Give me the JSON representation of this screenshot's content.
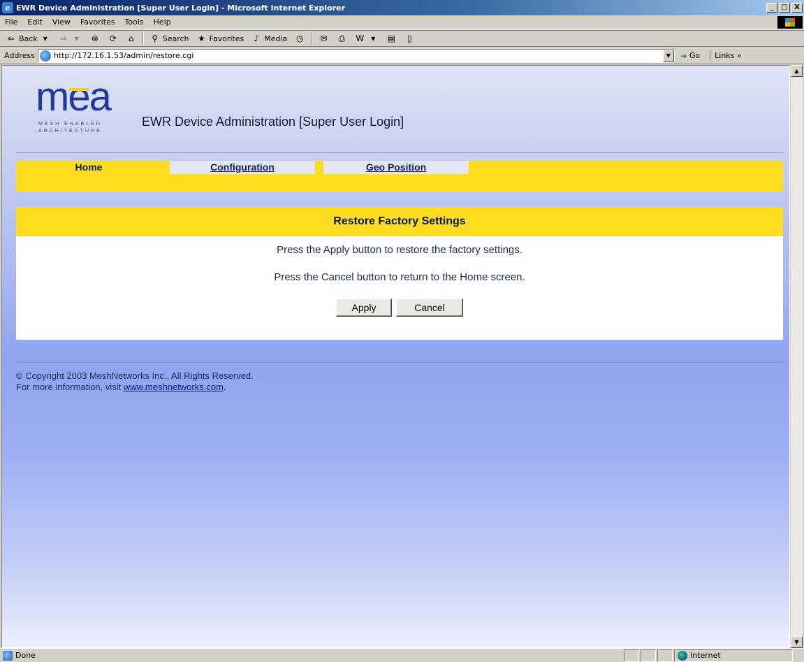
{
  "window": {
    "title": "EWR Device Administration [Super User Login] - Microsoft Internet Explorer",
    "minimize": "_",
    "maximize": "□",
    "close": "X"
  },
  "menubar": {
    "items": [
      "File",
      "Edit",
      "View",
      "Favorites",
      "Tools",
      "Help"
    ]
  },
  "toolbar": {
    "back": "Back",
    "search": "Search",
    "favorites": "Favorites",
    "media": "Media"
  },
  "address": {
    "label": "Address",
    "url": "http://172.16.1.53/admin/restore.cgi",
    "go": "Go",
    "links": "Links"
  },
  "page": {
    "logo_text": "mea",
    "logo_tag1": "MESH ENABLED",
    "logo_tag2": "ARCHITECTURE",
    "title": "EWR Device Administration [Super User Login]",
    "tabs": [
      "Home",
      "Configuration",
      "Geo Position"
    ],
    "panel_title": "Restore Factory Settings",
    "line1": "Press the Apply button to restore the factory settings.",
    "line2": "Press the Cancel button to return to the Home screen.",
    "apply": "Apply",
    "cancel": "Cancel",
    "copyright": "© Copyright 2003 MeshNetworks Inc., All Rights Reserved.",
    "more_info": "For more information, visit ",
    "link": "www.meshnetworks.com",
    "period": "."
  },
  "status": {
    "text": "Done",
    "zone": "Internet"
  },
  "colors": {
    "accent_yellow": "#fddd1e",
    "brand_blue": "#1f3c9a"
  }
}
